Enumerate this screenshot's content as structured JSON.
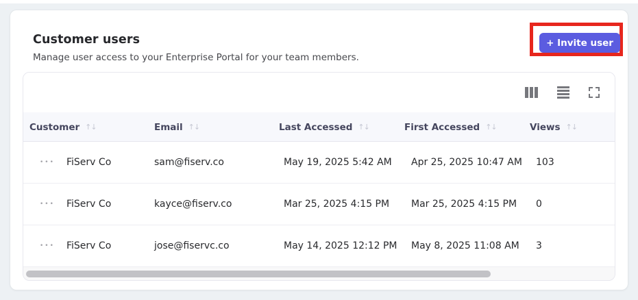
{
  "page": {
    "title": "Customer users",
    "subtitle": "Manage user access to your Enterprise Portal for your team members."
  },
  "actions": {
    "invite_button_label": "+ Invite user"
  },
  "toolbar": {
    "icons": [
      "columns-icon",
      "row-lines-icon",
      "fullscreen-icon"
    ]
  },
  "annotation": {
    "type": "highlight-box",
    "color": "#e7261d",
    "target": "invite-user-button"
  },
  "table": {
    "sort_glyph": "↑↓",
    "row_menu_glyph": "•••",
    "columns": [
      "Customer",
      "Email",
      "Last Accessed",
      "First Accessed",
      "Views"
    ],
    "rows": [
      {
        "customer": "FiServ Co",
        "email": "sam@fiserv.co",
        "last_accessed": "May 19, 2025 5:42 AM",
        "first_accessed": "Apr 25, 2025 10:47 AM",
        "views": "103"
      },
      {
        "customer": "FiServ Co",
        "email": "kayce@fiserv.co",
        "last_accessed": "Mar 25, 2025 4:15 PM",
        "first_accessed": "Mar 25, 2025 4:15 PM",
        "views": "0"
      },
      {
        "customer": "FiServ Co",
        "email": "jose@fiservc.co",
        "last_accessed": "May 14, 2025 12:12 PM",
        "first_accessed": "May 8, 2025 11:08 AM",
        "views": "3"
      }
    ]
  },
  "colors": {
    "accent": "#5b5ce0",
    "annotation_red": "#e7261d",
    "header_bg": "#f7f8fc",
    "page_bg": "#edf1f4"
  }
}
